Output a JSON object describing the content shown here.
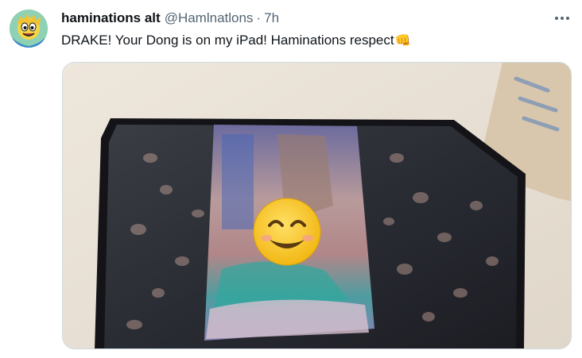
{
  "tweet": {
    "author": {
      "display_name": "haminations alt",
      "handle": "@Hamlnatlons",
      "avatar_icon": "cartoon-face-avatar"
    },
    "separator": "·",
    "timestamp": "7h",
    "text": "DRAKE! Your Dong is on my iPad! Haminations respect",
    "text_emoji": "👊",
    "more_icon": "more-horizontal-icon",
    "media": {
      "kind": "photo",
      "overlay_emoji": "smiling-face-emoji"
    }
  },
  "colors": {
    "text": "#0f1419",
    "secondary": "#536471",
    "border": "#cfd9de"
  }
}
